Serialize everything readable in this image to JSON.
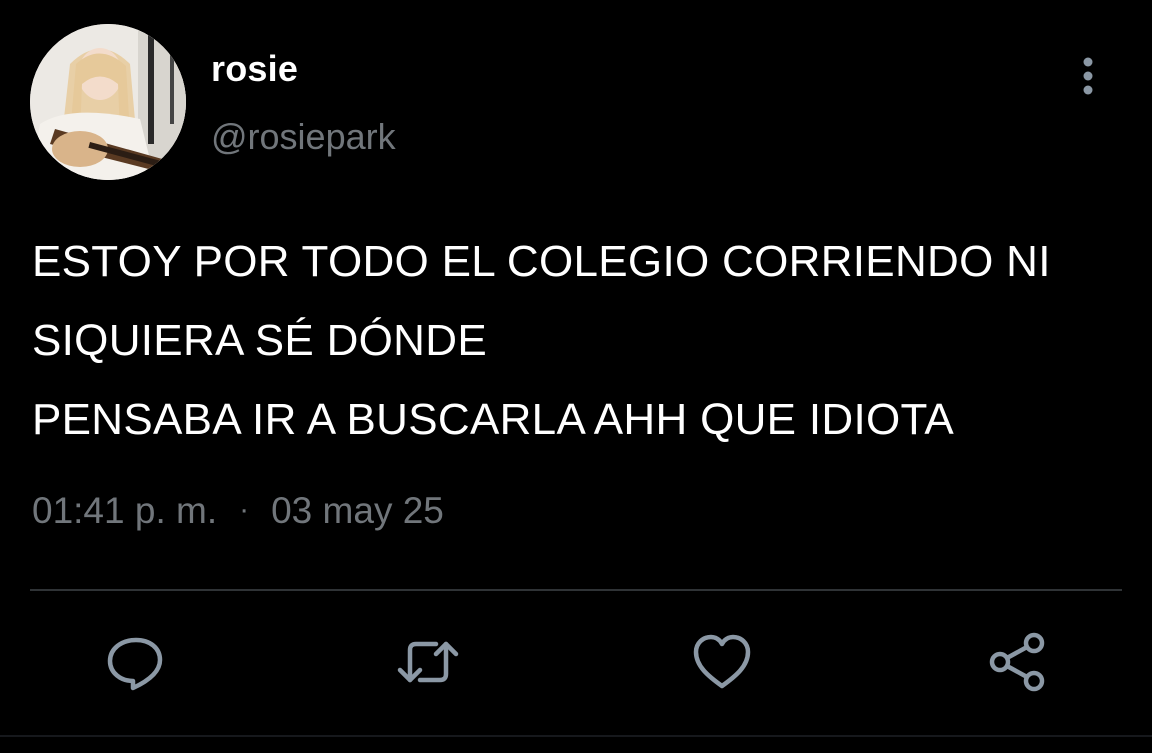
{
  "user": {
    "display_name": "rosie",
    "handle": "@rosiepark"
  },
  "tweet": {
    "lines": [
      "ESTOY POR TODO EL COLEGIO CORRIENDO NI",
      "SIQUIERA SÉ DÓNDE",
      "PENSABA IR A BUSCARLA AHH QUE IDIOTA"
    ],
    "time": "01:41 p. m.",
    "separator": "·",
    "date": "03 may 25"
  },
  "actions": [
    {
      "icon": "reply-icon"
    },
    {
      "icon": "retweet-icon"
    },
    {
      "icon": "like-icon"
    },
    {
      "icon": "share-icon"
    }
  ],
  "colors": {
    "background": "#000000",
    "text": "#ffffff",
    "secondary": "#71767b",
    "divider": "#2f3336",
    "icon": "#8b98a5"
  }
}
